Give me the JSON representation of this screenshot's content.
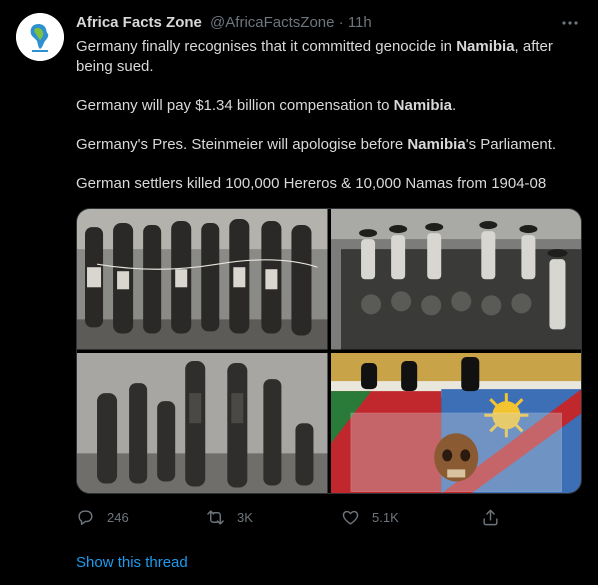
{
  "tweet": {
    "author_name": "Africa Facts Zone",
    "author_handle": "@AfricaFactsZone",
    "separator": "·",
    "time": "11h",
    "paragraphs": [
      {
        "before": "Germany finally recognises that it committed genocide in ",
        "bold": "Namibia",
        "after": ", after being sued."
      },
      {
        "before": "Germany will pay $1.34 billion compensation to ",
        "bold": "Namibia",
        "after": "."
      },
      {
        "before": "Germany's Pres. Steinmeier will apologise before ",
        "bold": "Namibia",
        "after": "'s Parliament."
      },
      {
        "before": "German settlers killed 100,000 Hereros & 10,000 Namas from 1904-08",
        "bold": "",
        "after": ""
      }
    ],
    "icons": {
      "more": "more-options-icon",
      "reply": "reply-icon",
      "retweet": "retweet-icon",
      "like": "heart-icon",
      "share": "share-icon"
    },
    "stats": {
      "replies": "246",
      "retweets": "3K",
      "likes": "5.1K"
    },
    "show_thread": "Show this thread"
  },
  "colors": {
    "background": "#000000",
    "text": "#d9d9d9",
    "muted": "#6e767d",
    "link": "#1d9bf0"
  }
}
